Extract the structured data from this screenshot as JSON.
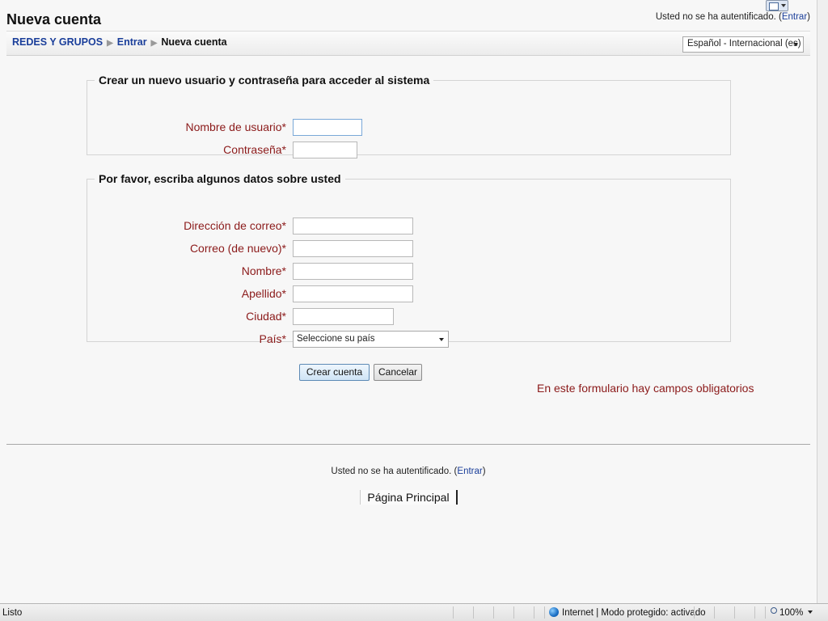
{
  "header": {
    "title": "Nueva cuenta",
    "login_text": "Usted no se ha autentificado. (",
    "login_link": "Entrar",
    "login_close": ")"
  },
  "breadcrumb": {
    "items": [
      "REDES Y GRUPOS",
      "Entrar",
      "Nueva cuenta"
    ],
    "separator": "▶"
  },
  "language_select": {
    "selected": "Español - Internacional (es)"
  },
  "section_account": {
    "legend": "Crear un nuevo usuario y contraseña para acceder al sistema",
    "fields": [
      {
        "label": "Nombre de usuario*",
        "value": ""
      },
      {
        "label": "Contraseña*",
        "value": ""
      }
    ]
  },
  "section_details": {
    "legend": "Por favor, escriba algunos datos sobre usted",
    "fields": [
      {
        "label": "Dirección de correo*",
        "value": ""
      },
      {
        "label": "Correo (de nuevo)*",
        "value": ""
      },
      {
        "label": "Nombre*",
        "value": ""
      },
      {
        "label": "Apellido*",
        "value": ""
      },
      {
        "label": "Ciudad*",
        "value": ""
      },
      {
        "label": "País*",
        "selected": "Seleccione su país"
      }
    ]
  },
  "buttons": {
    "create": "Crear cuenta",
    "cancel": "Cancelar"
  },
  "required_note": "En este formulario hay campos obligatorios",
  "footer": {
    "login_text": "Usted no se ha autentificado. (",
    "login_link": "Entrar",
    "login_close": ")",
    "home_link": "Página Principal"
  },
  "statusbar": {
    "left_text": "Listo",
    "zone_text": "Internet | Modo protegido: activado",
    "zoom": "100%"
  },
  "colors": {
    "label_red": "#8b1a1a",
    "link_blue": "#1a3e9a"
  }
}
